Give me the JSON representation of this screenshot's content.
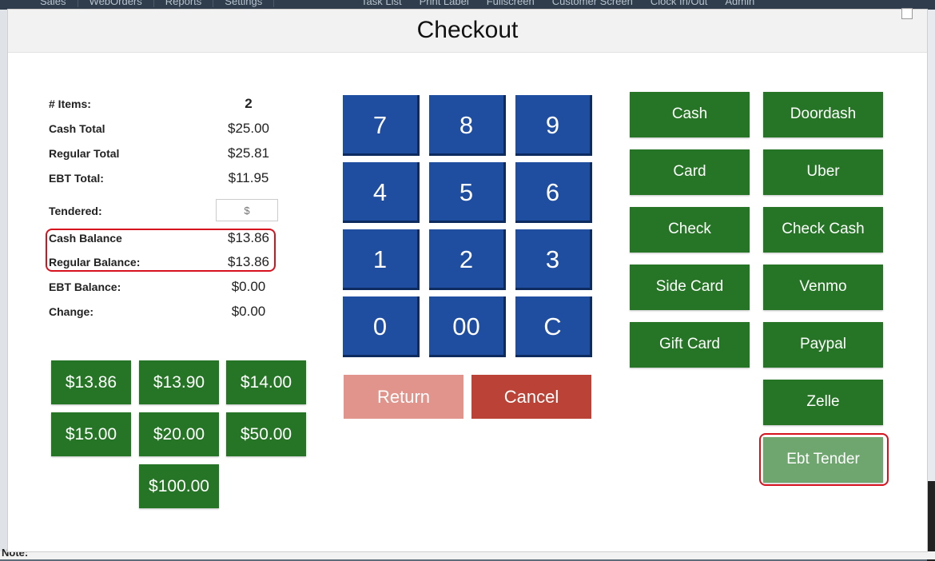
{
  "background": {
    "top_nav": [
      "Sales",
      "WebOrders",
      "Reports",
      "Settings"
    ],
    "top_right": [
      "Task List",
      "Print Label",
      "Fullscreen",
      "Customer Screen",
      "Clock In/Out",
      "Admin"
    ],
    "note_label": "Note:"
  },
  "modal": {
    "title": "Checkout"
  },
  "summary": {
    "items": {
      "label": "# Items:",
      "value": "2"
    },
    "cash_total": {
      "label": "Cash Total",
      "value": "$25.00"
    },
    "regular_total": {
      "label": "Regular Total",
      "value": "$25.81"
    },
    "ebt_total": {
      "label": "EBT Total:",
      "value": "$11.95"
    },
    "tendered": {
      "label": "Tendered:",
      "placeholder": "$"
    },
    "cash_balance": {
      "label": "Cash Balance",
      "value": "$13.86"
    },
    "regular_balance": {
      "label": "Regular Balance:",
      "value": "$13.86"
    },
    "ebt_balance": {
      "label": "EBT Balance:",
      "value": "$0.00"
    },
    "change": {
      "label": "Change:",
      "value": "$0.00"
    }
  },
  "quick_amounts": [
    "$13.86",
    "$13.90",
    "$14.00",
    "$15.00",
    "$20.00",
    "$50.00",
    "$100.00"
  ],
  "keypad": [
    "7",
    "8",
    "9",
    "4",
    "5",
    "6",
    "1",
    "2",
    "3",
    "0",
    "00",
    "C"
  ],
  "actions": {
    "return_label": "Return",
    "cancel_label": "Cancel"
  },
  "payment_methods": [
    "Cash",
    "Doordash",
    "Card",
    "Uber",
    "Check",
    "Check Cash",
    "Side Card",
    "Venmo",
    "Gift Card",
    "Paypal",
    "Zelle",
    "Ebt Tender"
  ],
  "colors": {
    "payment_green": "#267526",
    "keypad_blue": "#1f4ea0",
    "cancel_red": "#ba4237",
    "return_pink": "#e0948b",
    "highlight_red": "#d6121e"
  }
}
